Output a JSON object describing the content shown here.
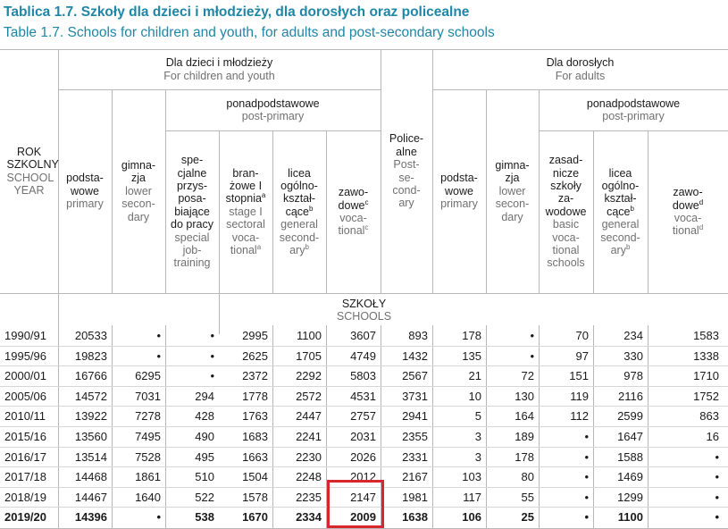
{
  "title_pl": "Tablica 1.7. Szkoły dla dzieci i młodzieży, dla dorosłych oraz policealne",
  "title_en": "Table 1.7. Schools for children and youth, for adults and post-secondary schools",
  "headers": {
    "year_pl": "ROK SZKOLNY",
    "year_en": "SCHOOL YEAR",
    "children_pl": "Dla dzieci i młodzieży",
    "children_en": "For children and youth",
    "adults_pl": "Dla dorosłych",
    "adults_en": "For adults",
    "ponad_pl": "ponadpodstawowe",
    "ponad_en": "post-primary",
    "primary_pl": "podsta-wowe",
    "primary_en": "primary",
    "gimn_pl": "gimna-zja",
    "gimn_en": "lower secon-dary",
    "special_pl": "spe-cjalne przys-posa-biające do pracy",
    "special_en": "special job-training",
    "branz_pl": "bran-żowe I stopnia",
    "branz_en": "stage I sectoral voca-tional",
    "licea_pl": "licea ogólno-kształ-cące",
    "licea_en": "general second-ary",
    "zawod_pl": "zawo-dowe",
    "zawod_en": "voca-tional",
    "polic_pl": "Police-alne",
    "polic_en": "Post-se-cond-ary",
    "zasad_pl": "zasad-nicze szkoły za-wodowe",
    "zasad_en": "basic voca-tional schools",
    "sup_a": "a",
    "sup_b": "b",
    "sup_c": "c",
    "sup_d": "d"
  },
  "section_pl": "SZKOŁY",
  "section_en": "SCHOOLS",
  "rows": [
    {
      "year": "1990/91",
      "v": [
        "20533",
        "•",
        "•",
        "2995",
        "1100",
        "3607",
        "893",
        "178",
        "•",
        "70",
        "234",
        "1583"
      ]
    },
    {
      "year": "1995/96",
      "v": [
        "19823",
        "•",
        "•",
        "2625",
        "1705",
        "4749",
        "1432",
        "135",
        "•",
        "97",
        "330",
        "1338"
      ]
    },
    {
      "year": "2000/01",
      "v": [
        "16766",
        "6295",
        "•",
        "2372",
        "2292",
        "5803",
        "2567",
        "21",
        "72",
        "151",
        "978",
        "1710"
      ]
    },
    {
      "year": "2005/06",
      "v": [
        "14572",
        "7031",
        "294",
        "1778",
        "2572",
        "4531",
        "3731",
        "10",
        "130",
        "119",
        "2116",
        "1752"
      ]
    },
    {
      "year": "2010/11",
      "v": [
        "13922",
        "7278",
        "428",
        "1763",
        "2447",
        "2757",
        "2941",
        "5",
        "164",
        "112",
        "2599",
        "863"
      ]
    },
    {
      "year": "2015/16",
      "v": [
        "13560",
        "7495",
        "490",
        "1683",
        "2241",
        "2031",
        "2355",
        "3",
        "189",
        "•",
        "1647",
        "16"
      ]
    },
    {
      "year": "2016/17",
      "v": [
        "13514",
        "7528",
        "495",
        "1663",
        "2230",
        "2026",
        "2331",
        "3",
        "178",
        "•",
        "1588",
        "•"
      ]
    },
    {
      "year": "2017/18",
      "v": [
        "14468",
        "1861",
        "510",
        "1504",
        "2248",
        "2012",
        "2167",
        "103",
        "80",
        "•",
        "1469",
        "•"
      ]
    },
    {
      "year": "2018/19",
      "v": [
        "14467",
        "1640",
        "522",
        "1578",
        "2235",
        "2147",
        "1981",
        "117",
        "55",
        "•",
        "1299",
        "•"
      ]
    },
    {
      "year": "2019/20",
      "v": [
        "14396",
        "•",
        "538",
        "1670",
        "2334",
        "2009",
        "1638",
        "106",
        "25",
        "•",
        "1100",
        "•"
      ],
      "bold": true
    }
  ]
}
